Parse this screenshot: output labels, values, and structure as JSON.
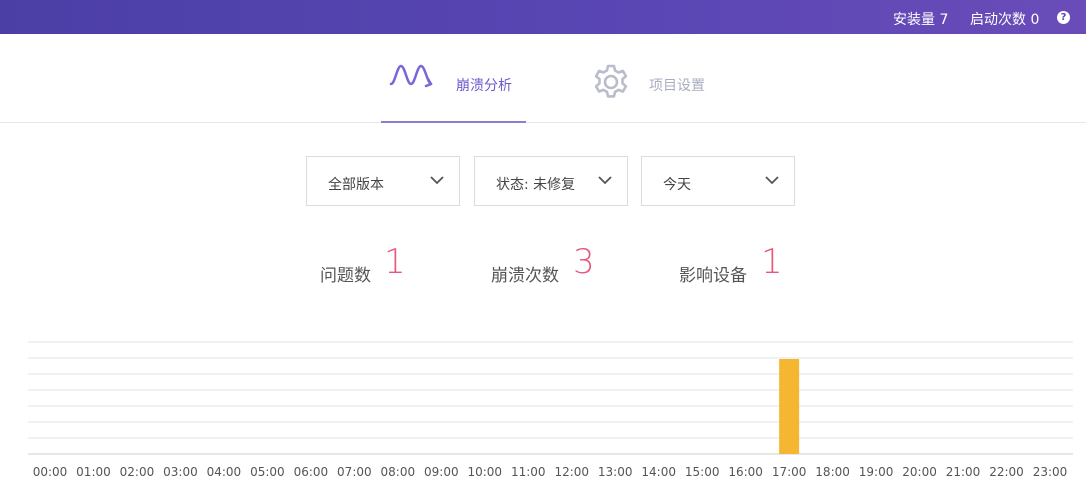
{
  "topbar": {
    "installs": "安装量 7",
    "launches": "启动次数 0",
    "help": "?"
  },
  "tabs": [
    {
      "label": "崩溃分析",
      "icon": "crash-wave-icon",
      "active": true
    },
    {
      "label": "项目设置",
      "icon": "gear-icon",
      "active": false
    }
  ],
  "filters": {
    "version": "全部版本",
    "status": "状态: 未修复",
    "period": "今天"
  },
  "metrics": [
    {
      "label": "问题数",
      "value": "1"
    },
    {
      "label": "崩溃次数",
      "value": "3"
    },
    {
      "label": "影响设备",
      "value": "1"
    }
  ],
  "colors": {
    "accent": "#6c5ac9",
    "metric_value": "#e8567a",
    "bar": "#f5b731"
  },
  "chart_data": {
    "type": "bar",
    "categories": [
      "00:00",
      "01:00",
      "02:00",
      "03:00",
      "04:00",
      "05:00",
      "06:00",
      "07:00",
      "08:00",
      "09:00",
      "10:00",
      "11:00",
      "12:00",
      "13:00",
      "14:00",
      "15:00",
      "16:00",
      "17:00",
      "18:00",
      "19:00",
      "20:00",
      "21:00",
      "22:00",
      "23:00"
    ],
    "values": [
      0,
      0,
      0,
      0,
      0,
      0,
      0,
      0,
      0,
      0,
      0,
      0,
      0,
      0,
      0,
      0,
      0,
      3,
      0,
      0,
      0,
      0,
      0,
      0
    ],
    "ylim": [
      0,
      3
    ],
    "grid": true
  }
}
